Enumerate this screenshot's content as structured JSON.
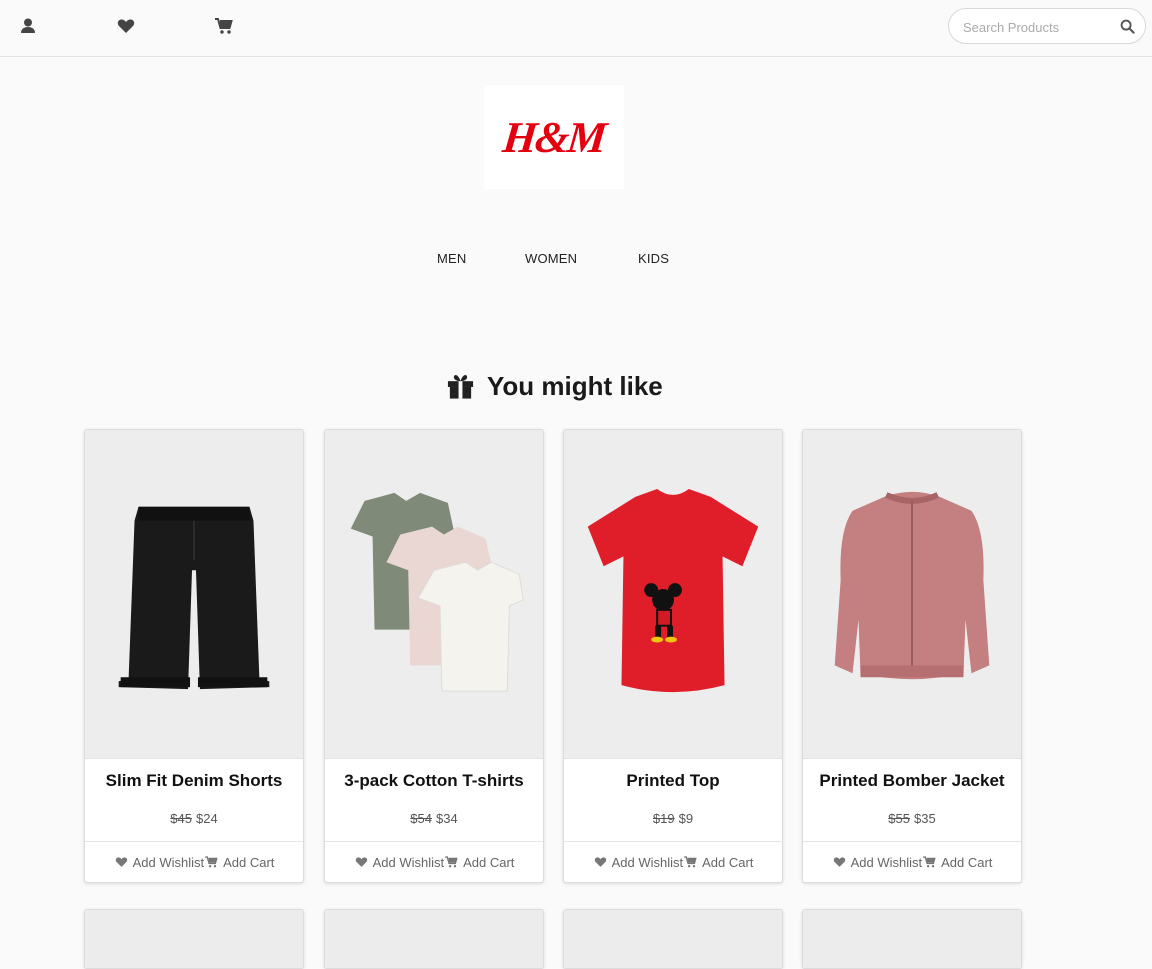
{
  "header": {
    "icons": [
      "user-icon",
      "heart-icon",
      "cart-icon"
    ],
    "search_placeholder": "Search Products"
  },
  "brand": {
    "logo_text": "H&M",
    "logo_color": "#e50010"
  },
  "nav": {
    "items": [
      "MEN",
      "WOMEN",
      "KIDS"
    ]
  },
  "section": {
    "title": "You might like",
    "icon": "gift-icon"
  },
  "products": [
    {
      "name": "Slim Fit Denim Shorts",
      "old_price": "$45",
      "price": "$24",
      "wishlist_label": "Add Wishlist",
      "cart_label": "Add Cart"
    },
    {
      "name": "3-pack Cotton T-shirts",
      "old_price": "$54",
      "price": "$34",
      "wishlist_label": "Add Wishlist",
      "cart_label": "Add Cart"
    },
    {
      "name": "Printed Top",
      "old_price": "$19",
      "price": "$9",
      "wishlist_label": "Add Wishlist",
      "cart_label": "Add Cart"
    },
    {
      "name": "Printed Bomber Jacket",
      "old_price": "$55",
      "price": "$35",
      "wishlist_label": "Add Wishlist",
      "cart_label": "Add Cart"
    }
  ],
  "colors": {
    "accent_red": "#e50010",
    "text": "#111111",
    "muted": "#666666"
  }
}
